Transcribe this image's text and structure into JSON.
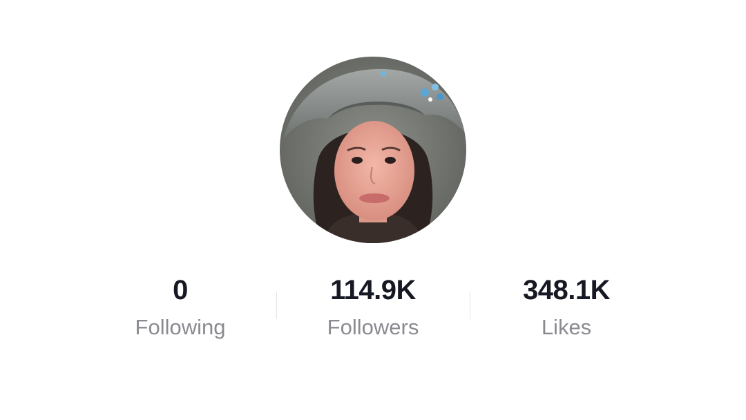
{
  "profile": {
    "avatar_alt": "profile-photo"
  },
  "stats": [
    {
      "value": "0",
      "label": "Following"
    },
    {
      "value": "114.9K",
      "label": "Followers"
    },
    {
      "value": "348.1K",
      "label": "Likes"
    }
  ],
  "colors": {
    "value_text": "#161823",
    "label_text": "#8a8b91",
    "divider": "#e3e3e4",
    "background": "#ffffff"
  }
}
